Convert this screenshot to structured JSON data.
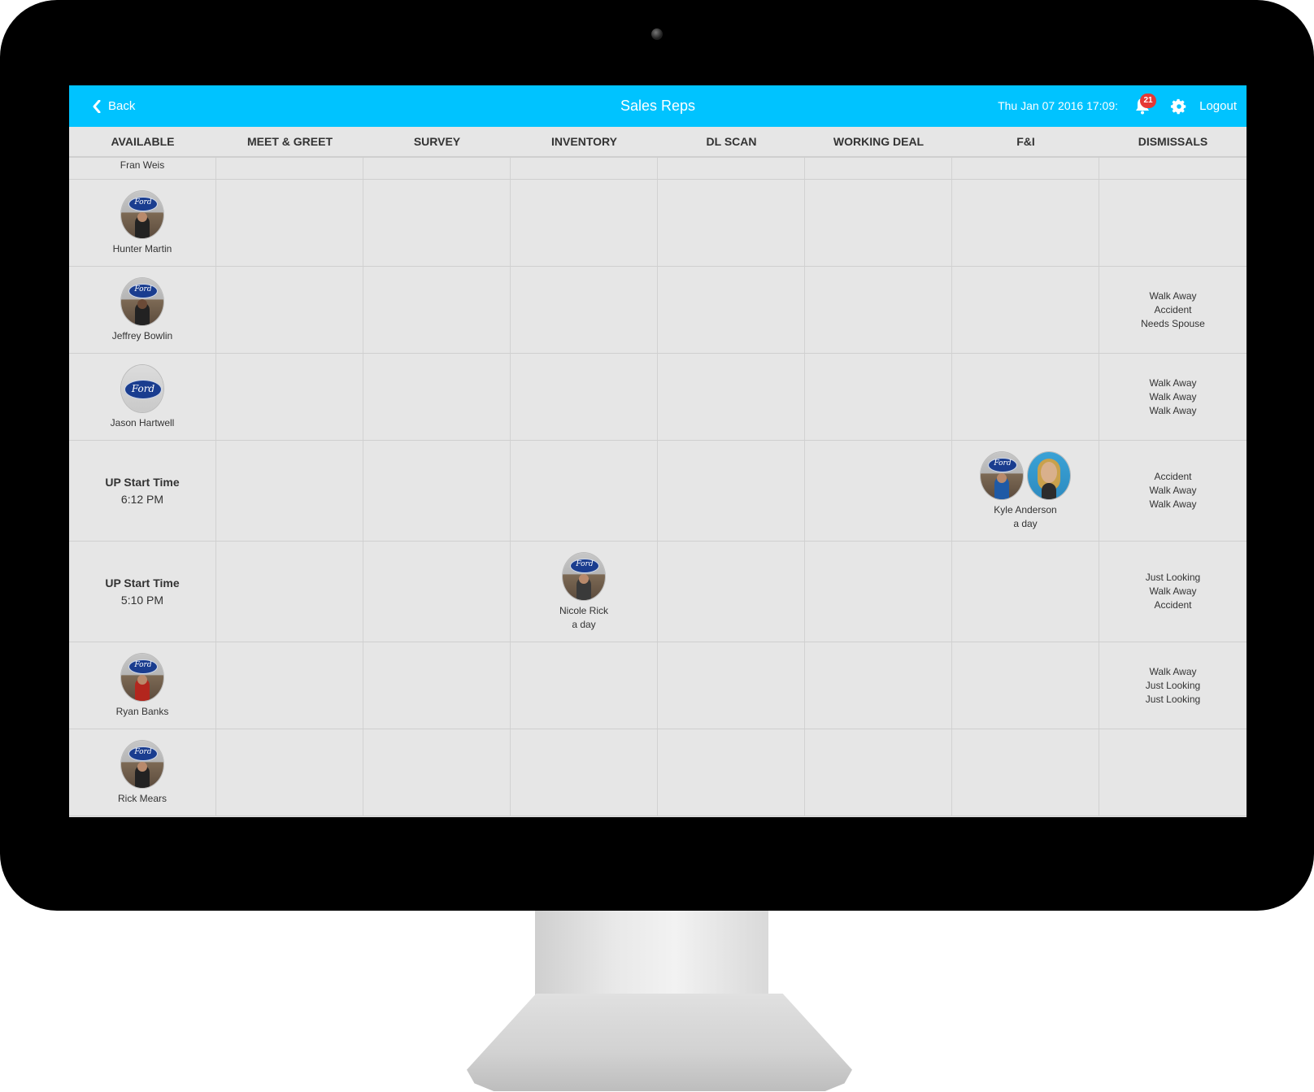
{
  "header": {
    "back_label": "Back",
    "title": "Sales Reps",
    "datetime": "Thu Jan 07 2016 17:09:",
    "notification_count": "21",
    "logout_label": "Logout",
    "accent_color": "#00c3ff"
  },
  "columns": [
    "AVAILABLE",
    "MEET & GREET",
    "SURVEY",
    "INVENTORY",
    "DL SCAN",
    "WORKING DEAL",
    "F&I",
    "DISMISSALS"
  ],
  "rows": [
    {
      "available": "Fran Weis"
    },
    {
      "available": "Hunter Martin"
    },
    {
      "available": "Jeffrey Bowlin",
      "dismissals": [
        "Walk Away",
        "Accident",
        "Needs Spouse"
      ]
    },
    {
      "available": "Jason Hartwell",
      "dismissals": [
        "Walk Away",
        "Walk Away",
        "Walk Away"
      ]
    },
    {
      "up_label": "UP Start Time",
      "up_time": "6:12 PM",
      "fi_name": "Kyle Anderson",
      "fi_sub": "a day",
      "dismissals": [
        "Accident",
        "Walk Away",
        "Walk Away"
      ]
    },
    {
      "up_label": "UP Start Time",
      "up_time": "5:10 PM",
      "inventory_name": "Nicole Rick",
      "inventory_sub": "a day",
      "dismissals": [
        "Just Looking",
        "Walk Away",
        "Accident"
      ]
    },
    {
      "available": "Ryan Banks",
      "dismissals": [
        "Walk Away",
        "Just Looking",
        "Just Looking"
      ]
    },
    {
      "available": "Rick Mears"
    }
  ]
}
